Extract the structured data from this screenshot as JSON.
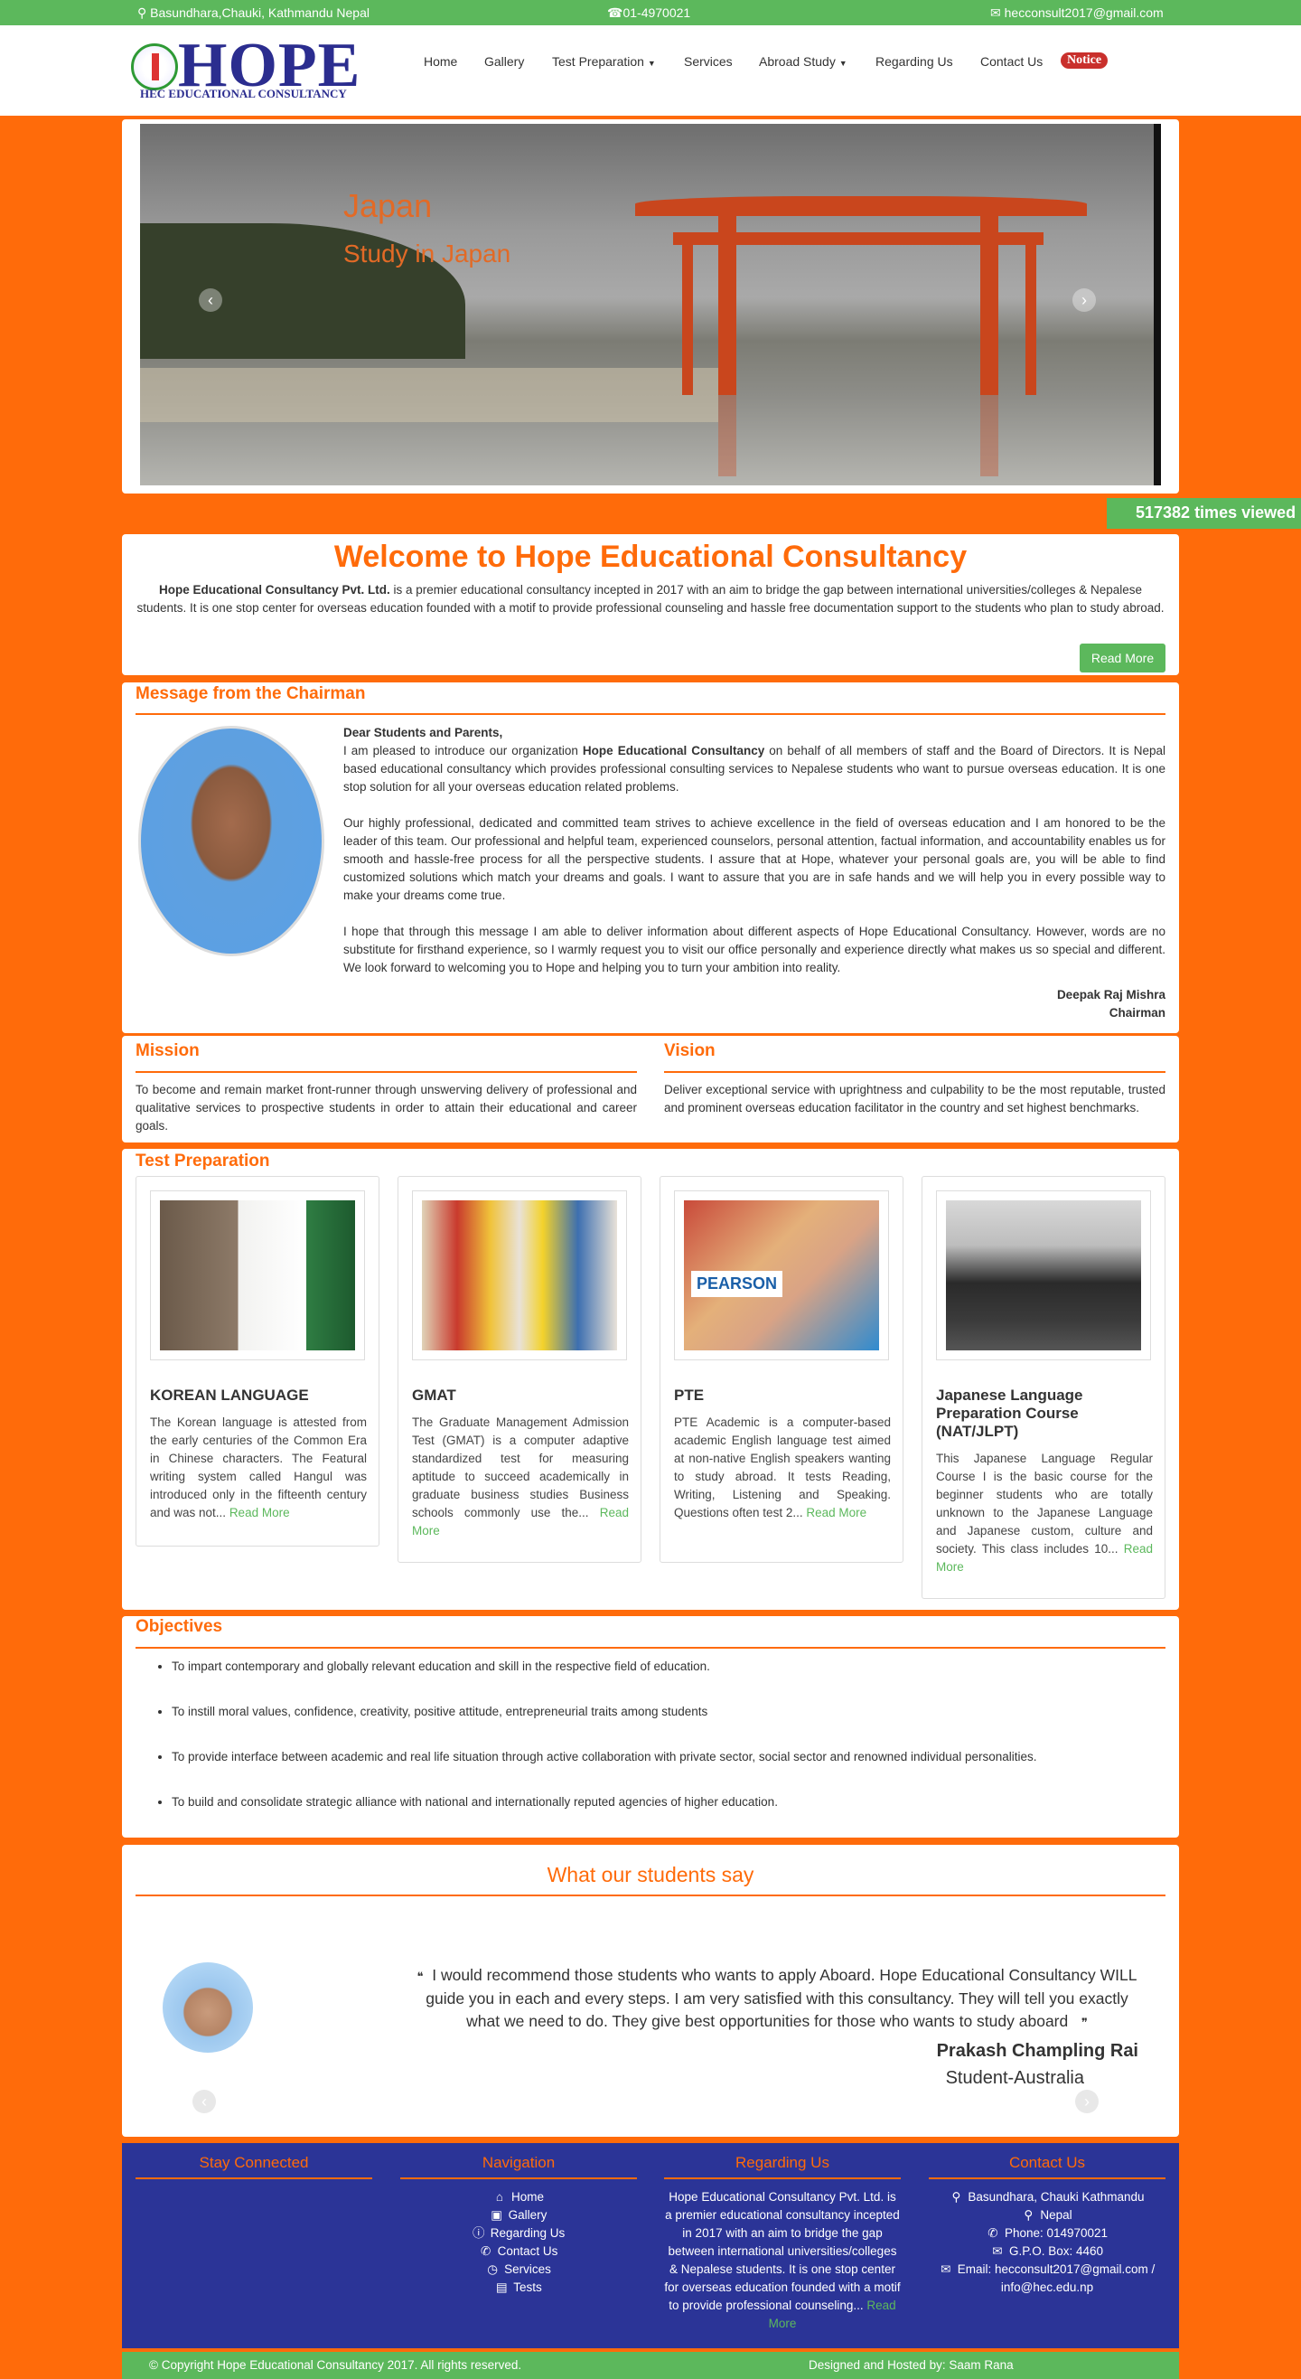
{
  "topbar": {
    "address": "Basundhara,Chauki, Kathmandu Nepal",
    "phone": "01-4970021",
    "email": "hecconsult2017@gmail.com"
  },
  "logo": {
    "big": "HOPE",
    "small": "HEC EDUCATIONAL CONSULTANCY"
  },
  "nav": {
    "home": "Home",
    "gallery": "Gallery",
    "test_prep": "Test Preparation",
    "services": "Services",
    "abroad": "Abroad Study",
    "regarding": "Regarding Us",
    "contact": "Contact Us",
    "notice": "Notice"
  },
  "slider": {
    "title": "Japan",
    "subtitle": "Study in Japan"
  },
  "counter": "517382 times viewed",
  "welcome": {
    "title": "Welcome to Hope Educational Consultancy",
    "company": "Hope Educational Consultancy Pvt. Ltd.",
    "text": " is a premier educational consultancy incepted in 2017 with an aim to bridge the gap between international universities/colleges & Nepalese students. It is one stop center for overseas education founded with a motif to provide professional counseling and hassle free documentation support to the students who plan to study abroad.",
    "button": "Read More"
  },
  "chairman": {
    "heading": "Message from the Chairman",
    "greeting": "Dear Students and Parents,",
    "p1a": "I am pleased to introduce our organization ",
    "p1b": "Hope Educational Consultancy",
    "p1c": " on behalf of all members of staff and the Board of Directors. It is Nepal based educational consultancy which provides professional consulting services to Nepalese students who want to pursue overseas education. It is one stop solution for all your overseas education related problems.",
    "p2": "Our highly professional, dedicated and committed team strives to achieve excellence in the field of overseas education and I am honored to be the leader of this team. Our professional and helpful team, experienced counselors, personal attention, factual information, and accountability enables us for smooth and hassle-free process for all the perspective students. I assure that at Hope, whatever your personal goals are, you will be able to find customized solutions which match your dreams and goals. I want to assure that you are in safe hands and we will help you in every possible way to make your dreams come true.",
    "p3": "I hope that through this message I am able to deliver information about different aspects of Hope Educational Consultancy. However, words are no substitute for firsthand experience, so I warmly request you to visit our office personally and experience directly what makes us so special and different. We look forward to welcoming you to Hope and helping you to turn your ambition into reality.",
    "name": "Deepak Raj Mishra",
    "title": "Chairman"
  },
  "mission": {
    "heading": "Mission",
    "text": "To become and remain market front-runner through unswerving delivery of professional and qualitative services to prospective students in order to attain their educational and career goals."
  },
  "vision": {
    "heading": "Vision",
    "text": "Deliver exceptional service with uprightness and culpability to be the most reputable, trusted and prominent overseas education facilitator in the country and set highest benchmarks."
  },
  "test_prep": {
    "heading": "Test Preparation",
    "prev": "prev",
    "next": "next",
    "read_more": "Read More",
    "cards": [
      {
        "title": "KOREAN LANGUAGE",
        "text": "The Korean language is attested from the early centuries of the Common Era in Chinese characters. The Featural writing system called Hangul was introduced only in the fifteenth century and was not... "
      },
      {
        "title": "GMAT",
        "text": "The Graduate Management Admission Test (GMAT) is a computer adaptive standardized test for measuring aptitude to succeed academically in graduate business studies Business schools commonly use the... "
      },
      {
        "title": "PTE",
        "text": "PTE Academic is a computer-based academic English language test aimed at non-native English speakers wanting to study abroad. It tests Reading, Writing, Listening and Speaking. Questions often test 2... ",
        "logo": "PEARSON"
      },
      {
        "title": "Japanese Language Preparation Course (NAT/JLPT)",
        "text": "This Japanese Language Regular Course I is the basic course for the beginner students who are totally unknown to the Japanese Language and Japanese custom, culture and society. This class includes 10... "
      }
    ]
  },
  "objectives": {
    "heading": "Objectives",
    "items": [
      "To impart contemporary and globally relevant education and skill in the respective field of education.",
      "To instill moral values, confidence, creativity, positive attitude, entrepreneurial traits among students",
      "To provide interface between academic and real life situation through active collaboration with private sector, social sector and renowned individual personalities.",
      "To build and consolidate strategic alliance with national and internationally reputed agencies of higher education."
    ]
  },
  "testimonial": {
    "heading": "What our students say",
    "quote": "I would recommend those students who wants to apply Aboard. Hope Educational Consultancy WILL guide you in each and every steps. I am very satisfied with this consultancy. They will tell you exactly what we need to do. They give best opportunities for those who wants to study aboard",
    "name": "Prakash Champling Rai",
    "role": "Student-Australia"
  },
  "footer": {
    "stay": "Stay Connected",
    "nav_heading": "Navigation",
    "nav_items": [
      "Home",
      "Gallery",
      "Regarding Us",
      "Contact Us",
      "Services",
      "Tests"
    ],
    "regarding_heading": "Regarding Us",
    "regarding_text": "Hope Educational Consultancy Pvt. Ltd. is a premier educational consultancy incepted in 2017 with an aim to bridge the gap between international universities/colleges & Nepalese students. It is one stop center for overseas education founded with a motif to provide professional counseling... ",
    "regarding_more": "Read More",
    "contact_heading": "Contact Us",
    "contact_address": "Basundhara, Chauki Kathmandu",
    "contact_country": "Nepal",
    "contact_phone": "Phone: 014970021",
    "contact_box": "G.P.O. Box: 4460",
    "contact_email": "Email: hecconsult2017@gmail.com / info@hec.edu.np",
    "copyright": "© Copyright Hope Educational Consultancy 2017. All rights reserved.",
    "designed": "Designed and Hosted by: Saam Rana"
  }
}
